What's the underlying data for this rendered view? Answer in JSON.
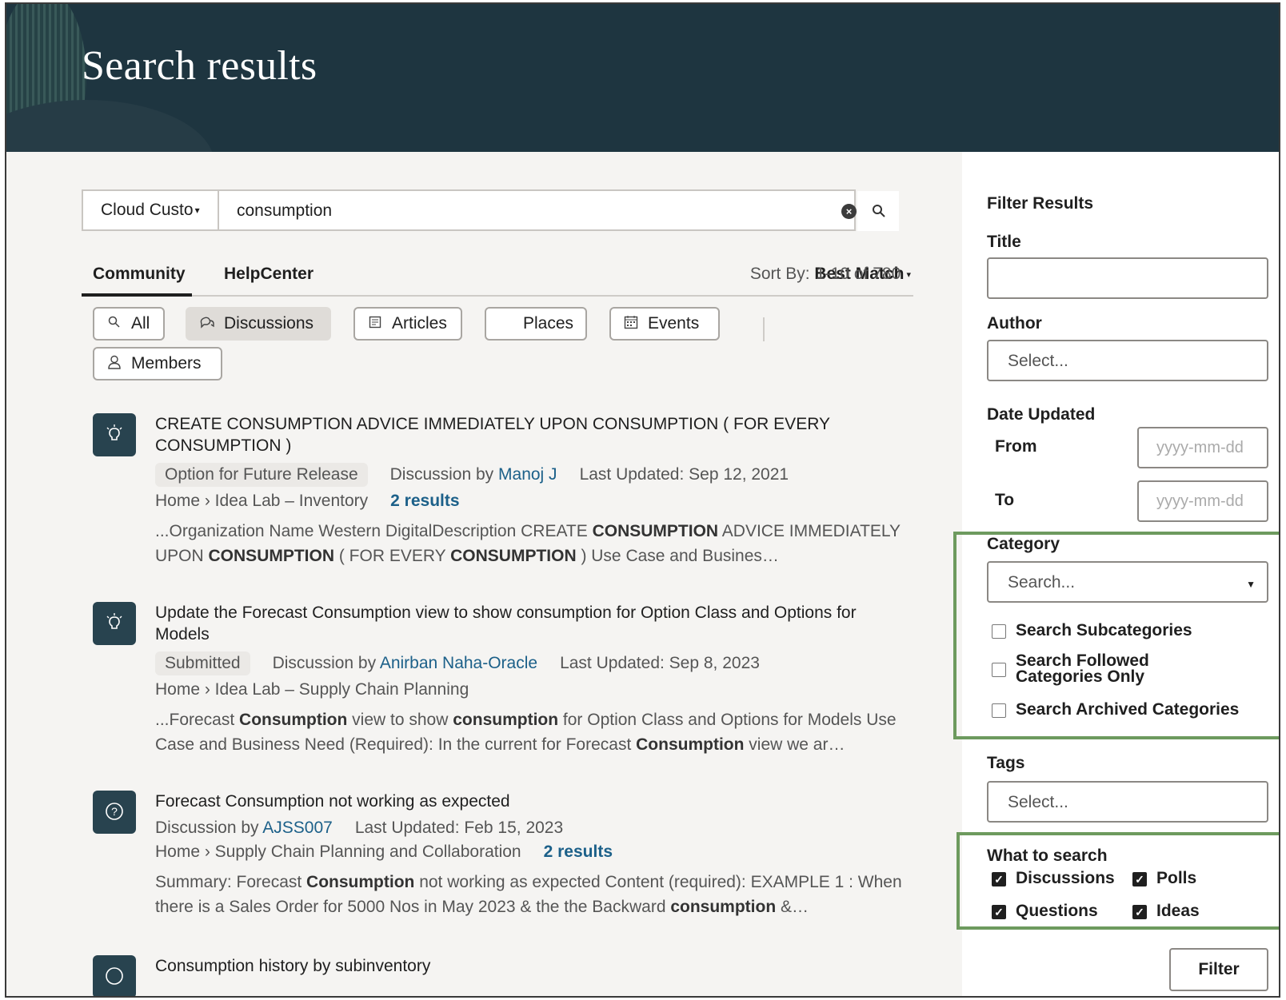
{
  "header": {
    "title": "Search results"
  },
  "search": {
    "scope_label": "Cloud Custo",
    "query": "consumption"
  },
  "tabs": [
    {
      "label": "Community",
      "active": true
    },
    {
      "label": "HelpCenter",
      "active": false
    }
  ],
  "sort": {
    "prefix": "Sort By:",
    "value": "Best Match",
    "range": "1-10 of 780"
  },
  "chips": [
    {
      "label": "All",
      "icon": "search-icon",
      "active": false
    },
    {
      "label": "Discussions",
      "icon": "chat-icon",
      "active": true
    },
    {
      "label": "Articles",
      "icon": "article-icon",
      "active": false
    },
    {
      "label": "Places",
      "icon": "",
      "active": false
    },
    {
      "label": "Events",
      "icon": "calendar-icon",
      "active": false
    },
    {
      "label": "Members",
      "icon": "person-icon",
      "active": false
    }
  ],
  "results": [
    {
      "icon": "lightbulb-icon",
      "title": "CREATE CONSUMPTION ADVICE IMMEDIATELY UPON CONSUMPTION ( FOR EVERY CONSUMPTION )",
      "badge": "Option for Future Release",
      "discussion_by": "Discussion by",
      "author": "Manoj J",
      "last_updated": "Last Updated: Sep 12, 2021",
      "crumb": "Home › Idea Lab – Inventory",
      "extra_results": "2 results",
      "snippet_html": "...Organization Name Western DigitalDescription CREATE <b>CONSUMPTION</b> ADVICE IMMEDIATELY UPON <b>CONSUMPTION</b> ( FOR EVERY <b>CONSUMPTION</b> ) Use Case and Busines…"
    },
    {
      "icon": "lightbulb-icon",
      "title": "Update the Forecast Consumption view to show consumption for Option Class and Options for Models",
      "badge": "Submitted",
      "discussion_by": "Discussion by",
      "author": "Anirban Naha-Oracle",
      "last_updated": "Last Updated: Sep 8, 2023",
      "crumb": "Home › Idea Lab – Supply Chain Planning",
      "extra_results": "",
      "snippet_html": "...Forecast <b>Consumption</b> view to show <b>consumption</b> for Option Class and Options for Models Use Case and Business Need (Required): In the current for Forecast <b>Consumption</b> view we ar…"
    },
    {
      "icon": "question-icon",
      "title": "Forecast Consumption not working as expected",
      "badge": "",
      "discussion_by": "Discussion by",
      "author": "AJSS007",
      "last_updated": "Last Updated: Feb 15, 2023",
      "crumb": "Home › Supply Chain Planning and Collaboration",
      "extra_results": "2 results",
      "snippet_html": "Summary: Forecast <b>Consumption</b> not working as expected Content (required): EXAMPLE 1 : When there is a Sales Order for 5000 Nos in May 2023 &amp; the the Backward <b>consumption</b> &amp;…"
    },
    {
      "icon": "question-icon",
      "title": "Consumption history by subinventory"
    }
  ],
  "sidebar": {
    "heading": "Filter Results",
    "title_label": "Title",
    "author_label": "Author",
    "author_placeholder": "Select...",
    "date_label": "Date Updated",
    "from_label": "From",
    "to_label": "To",
    "date_placeholder": "yyyy-mm-dd",
    "category_label": "Category",
    "category_placeholder": "Search...",
    "category_options": [
      {
        "label": "Search Subcategories",
        "checked": false
      },
      {
        "label": "Search Followed Categories Only",
        "checked": false
      },
      {
        "label": "Search Archived Categories",
        "checked": false
      }
    ],
    "tags_label": "Tags",
    "tags_placeholder": "Select...",
    "what_label": "What to search",
    "what_options": [
      {
        "label": "Discussions",
        "checked": true
      },
      {
        "label": "Polls",
        "checked": true
      },
      {
        "label": "Questions",
        "checked": true
      },
      {
        "label": "Ideas",
        "checked": true
      }
    ],
    "filter_button": "Filter"
  },
  "colors": {
    "header_bg": "#1e3540",
    "link": "#1c6089",
    "highlight": "#6d9a5e"
  }
}
